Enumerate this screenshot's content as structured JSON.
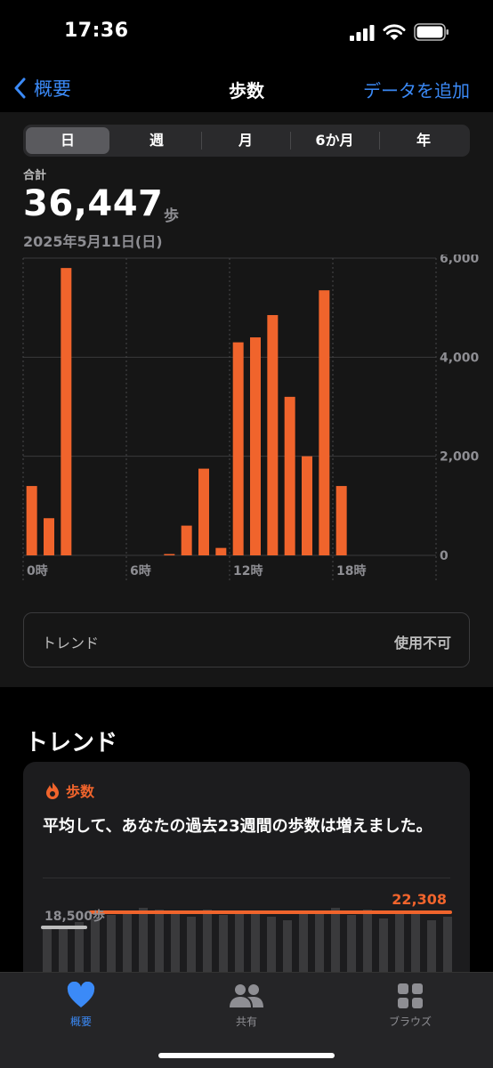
{
  "status": {
    "time": "17:36"
  },
  "nav": {
    "back_label": "概要",
    "title": "歩数",
    "action_label": "データを追加"
  },
  "segments": [
    "日",
    "週",
    "月",
    "6か月",
    "年"
  ],
  "summary": {
    "label": "合計",
    "value": "36,447",
    "unit": "歩",
    "date": "2025年5月11日(日)"
  },
  "chart_data": {
    "type": "bar",
    "x": [
      0,
      1,
      2,
      3,
      4,
      5,
      6,
      7,
      8,
      9,
      10,
      11,
      12,
      13,
      14,
      15,
      16,
      17,
      18,
      19,
      20,
      21,
      22,
      23
    ],
    "values": [
      1400,
      750,
      5800,
      0,
      0,
      0,
      0,
      0,
      10,
      600,
      1750,
      150,
      4300,
      4400,
      4850,
      3200,
      2000,
      5350,
      1400,
      0,
      0,
      0,
      0,
      0
    ],
    "x_tick_labels": [
      "0時",
      "6時",
      "12時",
      "18時"
    ],
    "y_tick_labels": [
      "6,000",
      "4,000",
      "2,000",
      "0"
    ],
    "ylim": [
      0,
      6000
    ],
    "color": "#f0642c"
  },
  "trend_box": {
    "label": "トレンド",
    "value": "使用不可"
  },
  "trends": {
    "heading": "トレンド",
    "card": {
      "category": "歩数",
      "text": "平均して、あなたの過去23週間の歩数は増えました。",
      "baseline_label": "18,500歩",
      "current_label": "22,308",
      "accent": "#f0642c"
    }
  },
  "tabs": [
    {
      "label": "概要",
      "icon": "heart-icon",
      "active": true
    },
    {
      "label": "共有",
      "icon": "people-icon",
      "active": false
    },
    {
      "label": "ブラウズ",
      "icon": "grid-icon",
      "active": false
    }
  ]
}
